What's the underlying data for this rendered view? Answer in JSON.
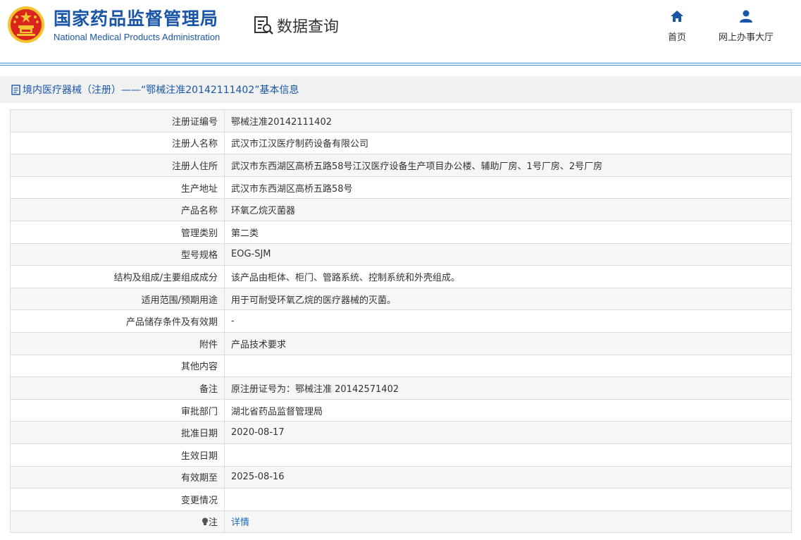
{
  "header": {
    "org_name_cn": "国家药品监督管理局",
    "org_name_en": "National Medical Products Administration",
    "query_label": "数据查询",
    "nav": {
      "home": "首页",
      "office": "网上办事大厅"
    }
  },
  "title": "境内医疗器械（注册）——“鄂械注准20142111402”基本信息",
  "rows": [
    {
      "label": "注册证编号",
      "value": "鄂械注准20142111402"
    },
    {
      "label": "注册人名称",
      "value": "武汉市江汉医疗制药设备有限公司"
    },
    {
      "label": "注册人住所",
      "value": "武汉市东西湖区高桥五路58号江汉医疗设备生产项目办公楼、辅助厂房、1号厂房、2号厂房"
    },
    {
      "label": "生产地址",
      "value": "武汉市东西湖区高桥五路58号"
    },
    {
      "label": "产品名称",
      "value": "环氧乙烷灭菌器"
    },
    {
      "label": "管理类别",
      "value": "第二类"
    },
    {
      "label": "型号规格",
      "value": "EOG-SJM"
    },
    {
      "label": "结构及组成/主要组成成分",
      "value": "该产品由柜体、柜门、管路系统、控制系统和外壳组成。"
    },
    {
      "label": "适用范围/预期用途",
      "value": "用于可耐受环氧乙烷的医疗器械的灭菌。"
    },
    {
      "label": "产品储存条件及有效期",
      "value": "-"
    },
    {
      "label": "附件",
      "value": "产品技术要求"
    },
    {
      "label": "其他内容",
      "value": ""
    },
    {
      "label": "备注",
      "value": "原注册证号为：鄂械注准 20142571402"
    },
    {
      "label": "审批部门",
      "value": "湖北省药品监督管理局"
    },
    {
      "label": "批准日期",
      "value": "2020-08-17"
    },
    {
      "label": "生效日期",
      "value": ""
    },
    {
      "label": "有效期至",
      "value": "2025-08-16"
    },
    {
      "label": "变更情况",
      "value": ""
    }
  ],
  "note_row": {
    "label": "注",
    "link_text": "详情"
  },
  "colors": {
    "brand_blue": "#1a56a8",
    "link_blue": "#1a6bb8",
    "emblem_red": "#d9251d",
    "emblem_gold": "#f4c430"
  },
  "icons": {
    "emblem": "national-emblem-icon",
    "query": "search-document-icon",
    "home": "home-icon",
    "office": "user-icon",
    "title": "document-icon",
    "note": "bulb-icon"
  }
}
